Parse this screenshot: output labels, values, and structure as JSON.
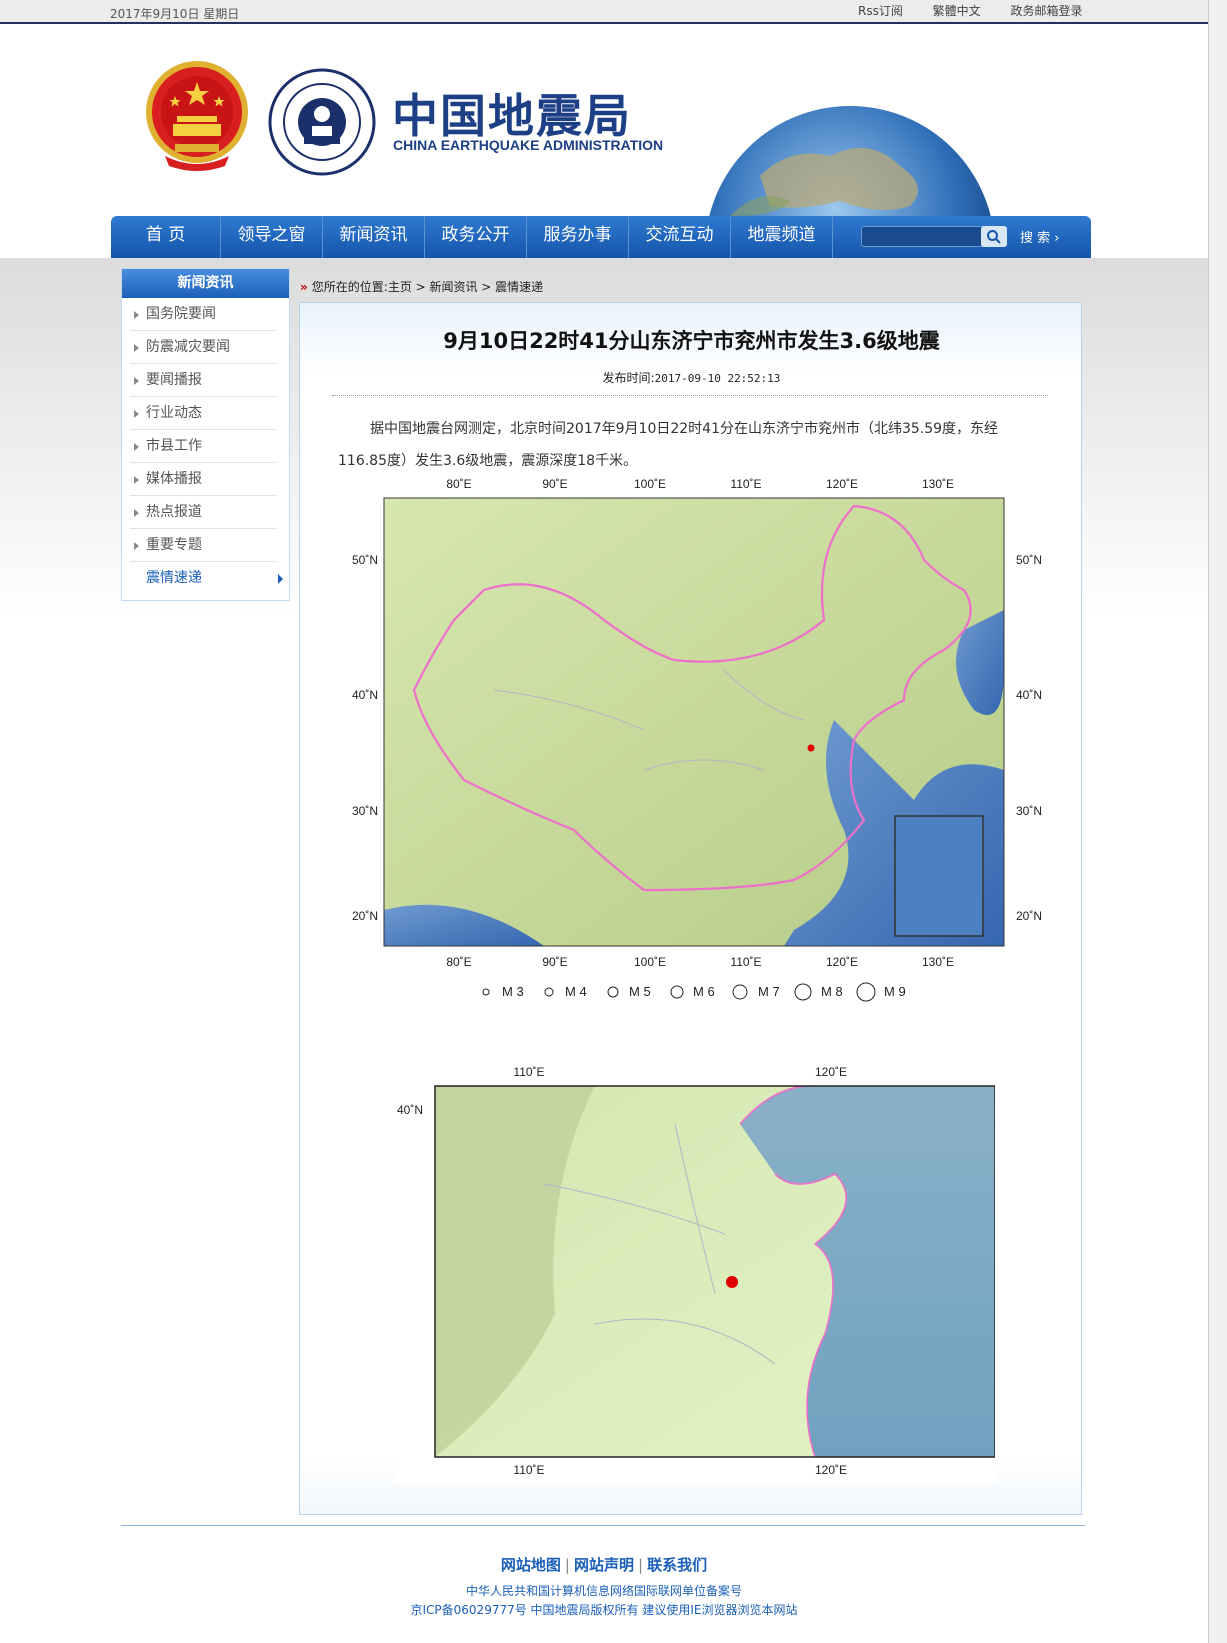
{
  "topbar": {
    "date": "2017年9月10日  星期日",
    "links": [
      "Rss订阅",
      "繁體中文",
      "政务邮箱登录"
    ]
  },
  "header": {
    "logo_cn": "中国地震局",
    "logo_en": "CHINA EARTHQUAKE ADMINISTRATION"
  },
  "nav": {
    "items": [
      "首 页",
      "领导之窗",
      "新闻资讯",
      "政务公开",
      "服务办事",
      "交流互动",
      "地震频道"
    ],
    "search_placeholder": "",
    "search_label": "搜  索"
  },
  "sidebar": {
    "title": "新闻资讯",
    "items": [
      "国务院要闻",
      "防震减灾要闻",
      "要闻播报",
      "行业动态",
      "市县工作",
      "媒体播报",
      "热点报道",
      "重要专题",
      "震情速递"
    ],
    "active": "震情速递"
  },
  "breadcrumb": {
    "prefix": "您所在的位置:",
    "path": "主页 > 新闻资讯 > 震情速递"
  },
  "article": {
    "title": "9月10日22时41分山东济宁市兖州市发生3.6级地震",
    "pub_label": "发布时间:",
    "pub_time": "2017-09-10 22:52:13",
    "body": "据中国地震台网测定，北京时间2017年9月10日22时41分在山东济宁市兖州市（北纬35.59度，东经116.85度）发生3.6级地震，震源深度18千米。"
  },
  "map1": {
    "lon_labels": [
      "80˚E",
      "90˚E",
      "100˚E",
      "110˚E",
      "120˚E",
      "130˚E"
    ],
    "lat_labels": [
      "50˚N",
      "40˚N",
      "30˚N",
      "20˚N"
    ],
    "legend": [
      "M 3",
      "M 4",
      "M 5",
      "M 6",
      "M 7",
      "M 8",
      "M 9"
    ]
  },
  "map2": {
    "lon_labels": [
      "110˚E",
      "120˚E"
    ],
    "lat_labels": [
      "40˚N"
    ]
  },
  "footer": {
    "links": [
      "网站地图",
      "网站声明",
      "联系我们"
    ],
    "info1": "中华人民共和国计算机信息网络国际联网单位备案号",
    "info2": "京ICP备06029777号  中国地震局版权所有  建议使用IE浏览器浏览本网站"
  },
  "colors": {
    "nav_blue": "#1c5fb5",
    "brand_blue": "#1c3f86",
    "epicenter": "#e00000"
  }
}
